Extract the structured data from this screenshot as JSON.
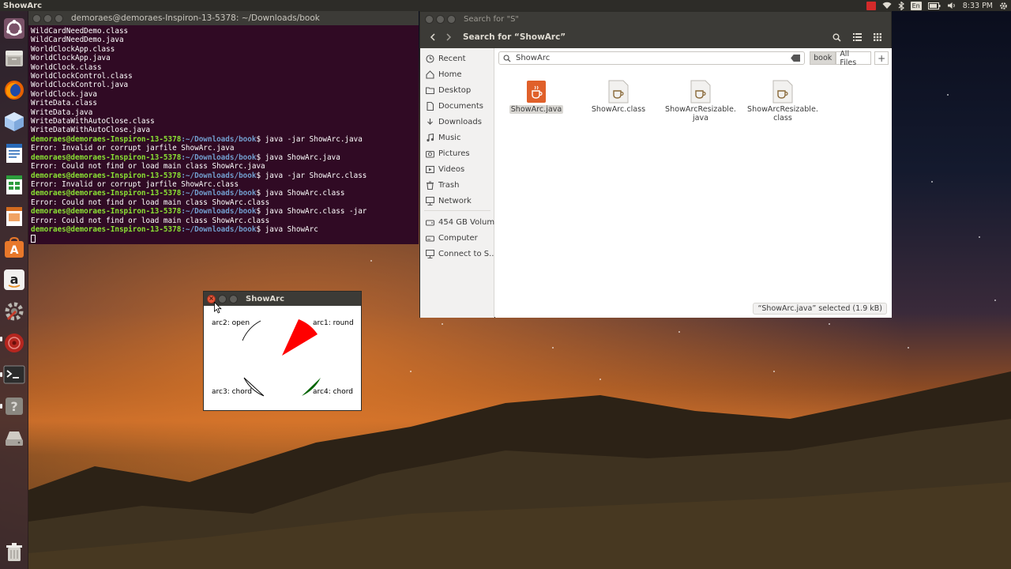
{
  "top_panel": {
    "app_title": "ShowArc",
    "keyboard_layout": "En",
    "clock": "8:33 PM"
  },
  "launcher": {
    "items": [
      "dash-icon",
      "files-icon",
      "firefox-icon",
      "generic-app-icon",
      "writer-icon",
      "calc-icon",
      "impress-icon",
      "software-center-icon",
      "amazon-icon",
      "settings-icon",
      "disk-icon",
      "terminal-icon",
      "help-icon",
      "drive-icon",
      "trash-icon"
    ]
  },
  "terminal": {
    "title": "demoraes@demoraes-Inspiron-13-5378: ~/Downloads/book",
    "plain_lines": [
      "WildCardNeedDemo.class",
      "WildCardNeedDemo.java",
      "WorldClockApp.class",
      "WorldClockApp.java",
      "WorldClock.class",
      "WorldClockControl.class",
      "WorldClockControl.java",
      "WorldClock.java",
      "WriteData.class",
      "WriteData.java",
      "WriteDataWithAutoClose.class",
      "WriteDataWithAutoClose.java"
    ],
    "prompt_user": "demoraes@demoraes-Inspiron-13-5378",
    "prompt_path": ":~/Downloads/book",
    "prompt_symbol": "$ ",
    "session": [
      {
        "cmd": "java -jar ShowArc.java",
        "out": "Error: Invalid or corrupt jarfile ShowArc.java"
      },
      {
        "cmd": "java ShowArc.java",
        "out": "Error: Could not find or load main class ShowArc.java"
      },
      {
        "cmd": "java -jar ShowArc.class",
        "out": "Error: Invalid or corrupt jarfile ShowArc.class"
      },
      {
        "cmd": "java ShowArc.class",
        "out": "Error: Could not find or load main class ShowArc.class"
      },
      {
        "cmd": "java ShowArc.class -jar",
        "out": "Error: Could not find or load main class ShowArc.class"
      },
      {
        "cmd": "java ShowArc",
        "out": ""
      }
    ]
  },
  "files": {
    "window_title": "Search for \"S\"",
    "header_path": "Search for “ShowArc”",
    "sidebar": {
      "recent": "Recent",
      "home": "Home",
      "desktop": "Desktop",
      "documents": "Documents",
      "downloads": "Downloads",
      "music": "Music",
      "pictures": "Pictures",
      "videos": "Videos",
      "trash": "Trash",
      "network": "Network",
      "volume": "454 GB Volume",
      "computer": "Computer",
      "connect": "Connect to S..."
    },
    "search": {
      "query": "ShowArc",
      "scope_current": "book",
      "scope_all": "All Files"
    },
    "items": [
      {
        "name": "ShowArc.java",
        "kind": "java",
        "selected": true
      },
      {
        "name": "ShowArc.class",
        "kind": "class"
      },
      {
        "name": "ShowArcResizable.java",
        "kind": "class",
        "line1": "ShowArcResizable.",
        "line2": "java"
      },
      {
        "name": "ShowArcResizable.class",
        "kind": "class",
        "line1": "ShowArcResizable.",
        "line2": "class"
      }
    ],
    "status": "“ShowArc.java” selected  (1.9 kB)"
  },
  "showarc": {
    "title": "ShowArc",
    "labels": {
      "arc1": "arc1: round",
      "arc2": "arc2: open",
      "arc3": "arc3: chord",
      "arc4": "arc4: chord"
    },
    "colors": {
      "arc1": "#ff0000",
      "arc2": "#000000",
      "arc3": "#000000",
      "arc4": "#006400"
    }
  }
}
